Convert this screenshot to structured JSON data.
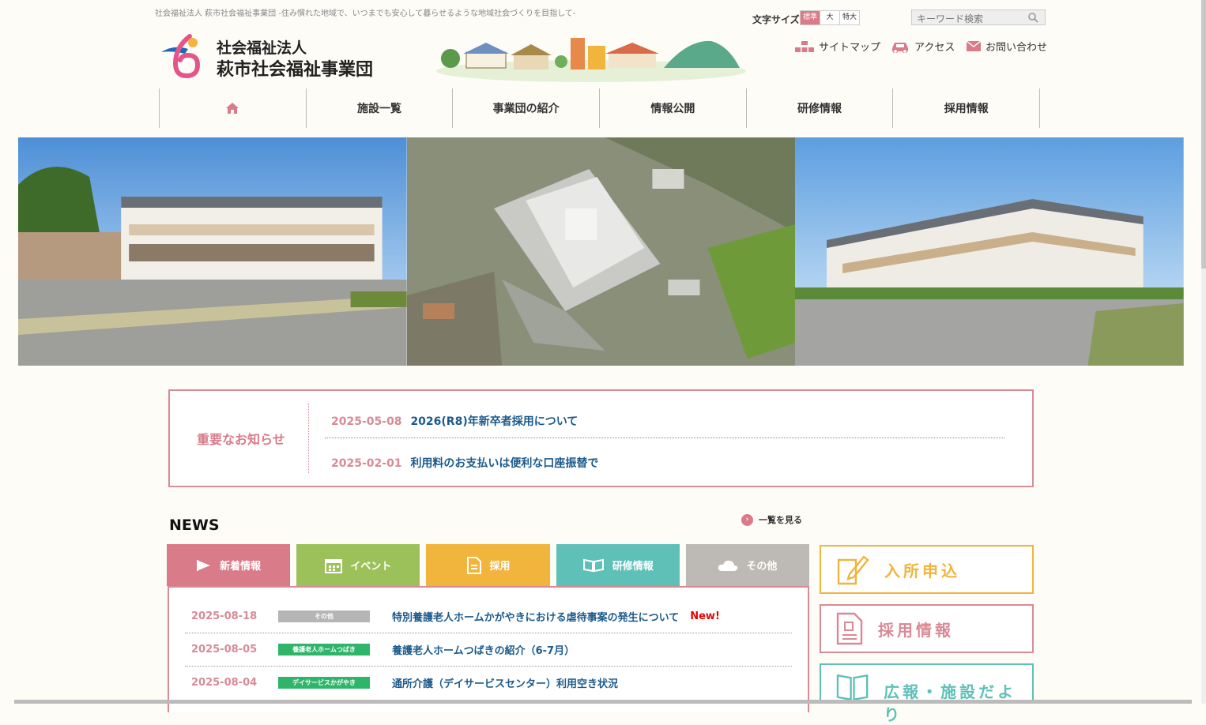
{
  "header": {
    "tagline": "社会福祉法人 萩市社会福祉事業団 -住み慣れた地域で、いつまでも安心して暮らせるような地域社会づくりを目指して-",
    "logo_line1": "社会福祉法人",
    "logo_line2": "萩市社会福祉事業団",
    "font_size_label": "文字サイズ",
    "font_sizes": [
      "標準",
      "大",
      "特大"
    ],
    "search_placeholder": "キーワード検索",
    "utility": {
      "sitemap": "サイトマップ",
      "access": "アクセス",
      "contact": "お問い合わせ"
    }
  },
  "nav": {
    "home_icon": "home-icon",
    "items": [
      "施設一覧",
      "事業団の紹介",
      "情報公開",
      "研修情報",
      "採用情報"
    ]
  },
  "notices": {
    "title": "重要なお知らせ",
    "items": [
      {
        "date": "2025-05-08",
        "text": "2026(R8)年新卒者採用について"
      },
      {
        "date": "2025-02-01",
        "text": "利用料のお支払いは便利な口座振替で"
      }
    ]
  },
  "news": {
    "heading": "NEWS",
    "more": "一覧を見る",
    "tabs": [
      {
        "label": "新着情報",
        "color": "#d97b88",
        "icon": "flag-icon"
      },
      {
        "label": "イベント",
        "color": "#9cc15a",
        "icon": "calendar-icon"
      },
      {
        "label": "採用",
        "color": "#f1b43c",
        "icon": "document-icon"
      },
      {
        "label": "研修情報",
        "color": "#5fc0b8",
        "icon": "book-icon"
      },
      {
        "label": "その他",
        "color": "#bdbab6",
        "icon": "cloud-icon"
      }
    ],
    "items": [
      {
        "date": "2025-08-18",
        "category": "その他",
        "cat_color": "#b5b5b5",
        "title": "特別養護老人ホームかがやきにおける虐待事案の発生について",
        "new": "New!"
      },
      {
        "date": "2025-08-05",
        "category": "養護老人ホームつばき",
        "cat_color": "#2fb56a",
        "title": "養護老人ホームつばきの紹介（6-7月）",
        "new": ""
      },
      {
        "date": "2025-08-04",
        "category": "デイサービスかがやき",
        "cat_color": "#2fb56a",
        "title": "通所介護（デイサービスセンター）利用空き状況",
        "new": ""
      }
    ]
  },
  "side": {
    "admission": {
      "label": "入所申込",
      "color": "#f1b43c"
    },
    "recruit": {
      "label": "採用情報",
      "color": "#d98a95"
    },
    "pr": {
      "label": "広報・施設だより",
      "color": "#5fc0b8"
    }
  }
}
